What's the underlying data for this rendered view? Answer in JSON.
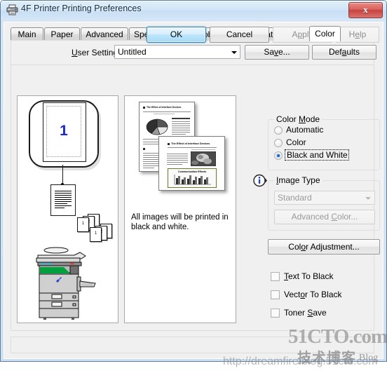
{
  "window": {
    "title": "4F Printer Printing Preferences",
    "printer_icon": "printer-icon",
    "close_label": "x"
  },
  "tabs": [
    {
      "label": "Main",
      "active": false
    },
    {
      "label": "Paper",
      "active": false
    },
    {
      "label": "Advanced",
      "active": false
    },
    {
      "label": "Special Modes",
      "active": false
    },
    {
      "label": "Job Handling",
      "active": false
    },
    {
      "label": "Watermarks",
      "active": false
    },
    {
      "label": "Color",
      "active": true
    }
  ],
  "user_settings": {
    "label": "User Settings:",
    "value": "Untitled",
    "save_label": "Save...",
    "defaults_label": "Defaults"
  },
  "left_preview": {
    "page_number": "1",
    "stack_labels": [
      "1",
      "2",
      "3"
    ]
  },
  "center_preview": {
    "doc_back_title": "The Effect of Interface Devices",
    "doc_front_title": "The Effect of Interface Devices",
    "doc_front_chart_title": "Communication Effects",
    "caption": "All images will be printed in black and white."
  },
  "color_mode": {
    "group_label": "Color Mode",
    "options": [
      {
        "label": "Automatic",
        "selected": false
      },
      {
        "label": "Color",
        "selected": false
      },
      {
        "label": "Black and White",
        "selected": true
      }
    ]
  },
  "image_type": {
    "group_label": "Image Type",
    "info_icon": "info-icon",
    "value": "Standard",
    "enabled": false,
    "advanced_color_label": "Advanced Color...",
    "advanced_color_enabled": false
  },
  "color_adjustment": {
    "label": "Color Adjustment..."
  },
  "checkboxes": [
    {
      "label": "Text To Black",
      "checked": false
    },
    {
      "label": "Vector To Black",
      "checked": false
    },
    {
      "label": "Toner Save",
      "checked": false
    }
  ],
  "dialog_buttons": {
    "ok": "OK",
    "cancel": "Cancel",
    "apply": "Apply",
    "help": "Help",
    "apply_enabled": false,
    "help_enabled": false
  },
  "watermarks": {
    "brand": "51CTO.com",
    "chinese": "技术博客",
    "blog": "Blog",
    "url": "http://dreamfire.blog.51cto.com"
  },
  "colors": {
    "accent_blue": "#1a6fc4",
    "page_number_blue": "#1a27d8",
    "titlebar_text": "#0c2a47",
    "close_red": "#c6423f",
    "window_bg": "#f0f0f0",
    "printer_green": "#00a03c"
  }
}
